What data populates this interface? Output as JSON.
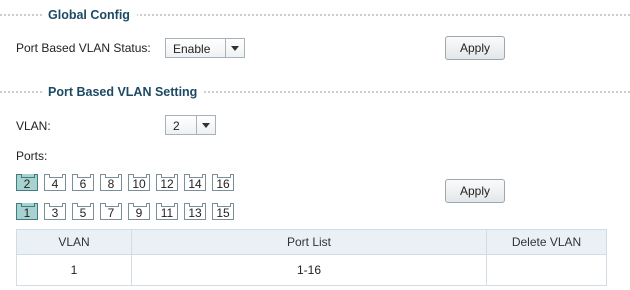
{
  "global_config": {
    "section_title": "Global Config",
    "status_label": "Port Based VLAN Status:",
    "status_value": "Enable",
    "apply_label": "Apply"
  },
  "vlan_setting": {
    "section_title": "Port Based VLAN Setting",
    "vlan_label": "VLAN:",
    "vlan_value": "2",
    "ports_label": "Ports:",
    "top_ports": [
      {
        "label": "2",
        "selected": true
      },
      {
        "label": "4",
        "selected": false
      },
      {
        "label": "6",
        "selected": false
      },
      {
        "label": "8",
        "selected": false
      },
      {
        "label": "10",
        "selected": false
      },
      {
        "label": "12",
        "selected": false
      },
      {
        "label": "14",
        "selected": false
      },
      {
        "label": "16",
        "selected": false
      }
    ],
    "bottom_ports": [
      {
        "label": "1",
        "selected": true
      },
      {
        "label": "3",
        "selected": false
      },
      {
        "label": "5",
        "selected": false
      },
      {
        "label": "7",
        "selected": false
      },
      {
        "label": "9",
        "selected": false
      },
      {
        "label": "11",
        "selected": false
      },
      {
        "label": "13",
        "selected": false
      },
      {
        "label": "15",
        "selected": false
      }
    ],
    "apply_label": "Apply"
  },
  "table": {
    "headers": {
      "vlan": "VLAN",
      "port_list": "Port List",
      "delete": "Delete VLAN"
    },
    "rows": [
      {
        "vlan": "1",
        "port_list": "1-16",
        "delete": ""
      }
    ]
  }
}
